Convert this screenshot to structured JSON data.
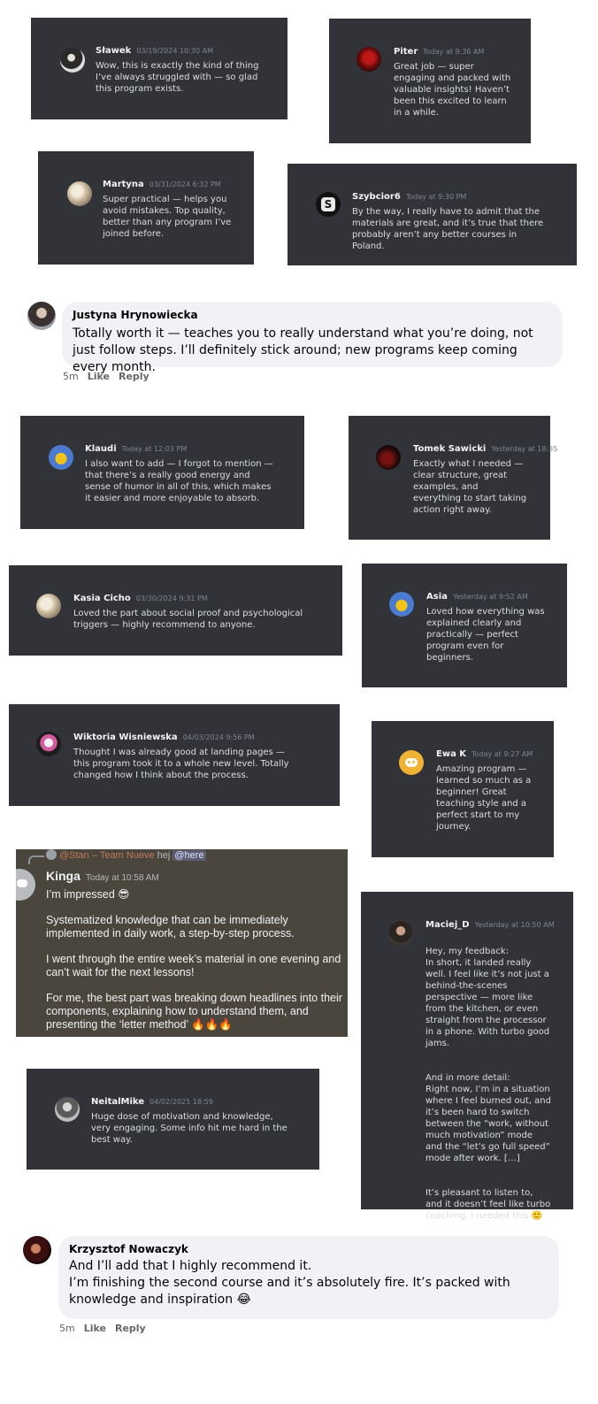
{
  "cards": [
    {
      "name": "Sławek",
      "time": "03/19/2024 10:30 AM",
      "text": "Wow, this is exactly the kind of thing I’ve always struggled with — so glad this program exists.",
      "avatar": "dark-portrait-avatar"
    },
    {
      "name": "Piter",
      "time": "Today at 9:36 AM",
      "text": "Great job — super engaging and packed with valuable insights! Haven’t been this excited to learn in a while.",
      "avatar": "red-avatar"
    },
    {
      "name": "Martyna",
      "time": "03/31/2024 6:32 PM",
      "text": "Super practical — helps you avoid mistakes. Top quality, better than any program I’ve joined before.",
      "avatar": "blonde-avatar"
    },
    {
      "name": "Szybcior6",
      "time": "Today at 9:30 PM",
      "text": "By the way, I really have to admit that the materials are great, and it’s true that there probably aren’t any better courses in Poland.",
      "avatar": "s-logo-avatar"
    },
    {
      "name": "Klaudi",
      "time": "Today at 12:03 PM",
      "text": "I also want to add — I forgot to mention — that there’s a really good energy and sense of humor in all of this, which makes it easier and more enjoyable to absorb.",
      "avatar": "pokemon-avatar"
    },
    {
      "name": "Tomek Sawicki",
      "time": "Yesterday at 18:35",
      "text": "Exactly what I needed — clear structure, great examples, and everything to start taking action right away.",
      "avatar": "dark-red-avatar"
    },
    {
      "name": "Kasia Cicho",
      "time": "03/30/2024 9:31 PM",
      "text": "Loved the part about social proof and psychological triggers — highly recommend to anyone.",
      "avatar": "blonde-avatar"
    },
    {
      "name": "Asia",
      "time": "Yesterday at 9:52 AM",
      "text": "Loved how everything was explained clearly and practically — perfect program even for beginners.",
      "avatar": "pokemon-avatar"
    },
    {
      "name": "Wiktoria Wisniewska",
      "time": "04/03/2024 9:56 PM",
      "text": "Thought I was already good at landing pages — this program took it to a whole new level. Totally changed how I think about the process.",
      "avatar": "anime-avatar"
    },
    {
      "name": "Ewa K",
      "time": "Today at 9:27 AM",
      "text": "Amazing program — learned so much as a beginner! Great teaching style and a perfect start to my journey.",
      "avatar": "discord-logo-avatar"
    },
    {
      "name": "NeitalMike",
      "time": "04/02/2025 18:59",
      "text": "Huge dose of motivation and knowledge, very engaging. Some info hit me hard in the best way.",
      "avatar": "grey-portrait-avatar"
    },
    {
      "name": "Maciej_D",
      "time": "Yesterday at 10:50 AM",
      "paragraphs": [
        "Hey, my feedback:\nIn short, it landed really well. I feel like it’s not just a behind-the-scenes perspective — more like from the kitchen, or even straight from the processor in a phone. With turbo good jams.",
        "And in more detail:\nRight now, I’m in a situation where I feel burned out, and it’s been hard to switch between the “work, without much motivation” mode and the “let’s go full speed” mode after work. […]",
        "It’s pleasant to listen to, and it doesn’t feel like turbo coaching. I needed this 🙂"
      ],
      "avatar": "bearded-portrait-avatar"
    }
  ],
  "kinga": {
    "reply_mention": "@Stan – Team Nueve",
    "reply_text": "hej",
    "reply_here": "@here",
    "name": "Kinga",
    "time": "Today at 10:58 AM",
    "paragraphs": [
      "I’m impressed 😎",
      "Systematized knowledge that can be immediately implemented in daily work, a step-by-step process.",
      "I went through the entire week’s material in one evening and can’t wait for the next lessons!",
      "For me, the best part was breaking down headlines into their components, explaining how to understand them, and presenting the ‘letter method’ 🔥🔥🔥"
    ]
  },
  "fb_comments": [
    {
      "name": "Justyna Hrynowiecka",
      "lines": [
        "Totally worth it — teaches you to really understand what you’re doing, not just follow steps. I’ll definitely stick around; new programs keep coming every month."
      ],
      "time": "5m",
      "like": "Like",
      "reply": "Reply"
    },
    {
      "name": "Krzysztof Nowaczyk",
      "lines": [
        "And I’ll add that I highly recommend it.",
        "I’m finishing the second course and it’s absolutely fire. It’s packed with knowledge and inspiration 😂"
      ],
      "time": "5m",
      "like": "Like",
      "reply": "Reply"
    }
  ],
  "colors": {
    "discord_bg": "#313338",
    "kinga_bg": "#4a453d",
    "fb_bubble": "#f0f2f5",
    "fb_meta": "#65676b"
  }
}
